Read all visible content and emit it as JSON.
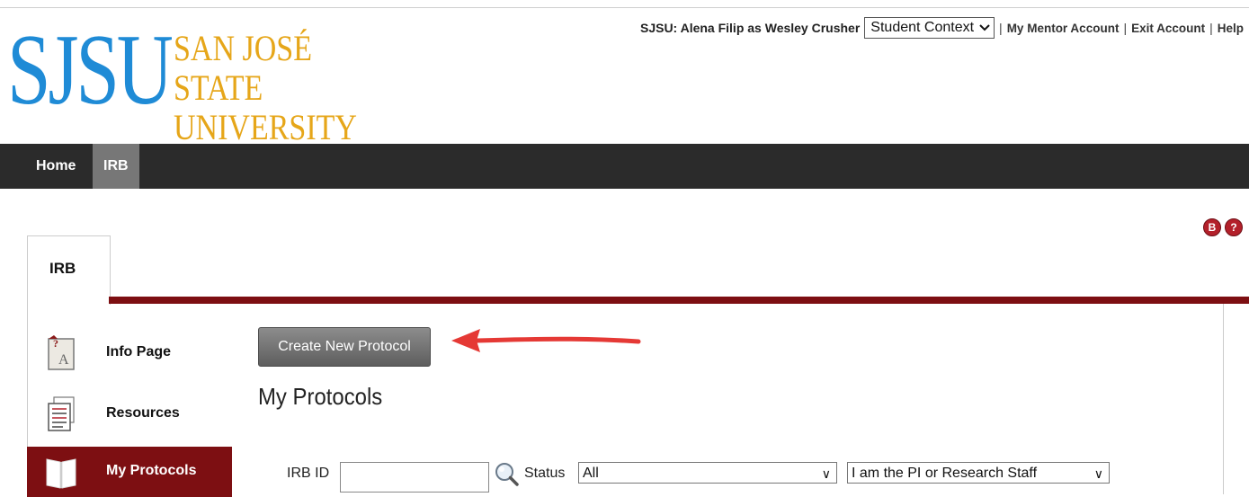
{
  "logo": {
    "abbrev": "SJSU",
    "line1": "SAN JOSÉ STATE",
    "line2": "UNIVERSITY"
  },
  "account": {
    "user_text": "SJSU: Alena Filip as Wesley Crusher",
    "context_value": "Student Context",
    "links": [
      "My Mentor Account",
      "Exit Account",
      "Help"
    ]
  },
  "nav": {
    "items": [
      "Home",
      "IRB"
    ],
    "active": "IRB"
  },
  "module_tab": "IRB",
  "sidebar": {
    "items": [
      {
        "label": "Info Page",
        "icon": "info-page-icon"
      },
      {
        "label": "Resources",
        "icon": "resources-icon"
      },
      {
        "label": "My Protocols",
        "icon": "book-icon",
        "active": true
      }
    ]
  },
  "main": {
    "create_button": "Create New Protocol",
    "title": "My Protocols",
    "filters": {
      "irb_id_label": "IRB ID",
      "irb_id_value": "",
      "status_label": "Status",
      "status_value": "All",
      "role_value": "I am the PI or Research Staff"
    }
  },
  "colors": {
    "brand_blue": "#1f8bd6",
    "brand_gold": "#e6a619",
    "accent_maroon": "#7d0f12",
    "nav_dark": "#2b2b2b",
    "annotation_arrow": "#e53935"
  }
}
